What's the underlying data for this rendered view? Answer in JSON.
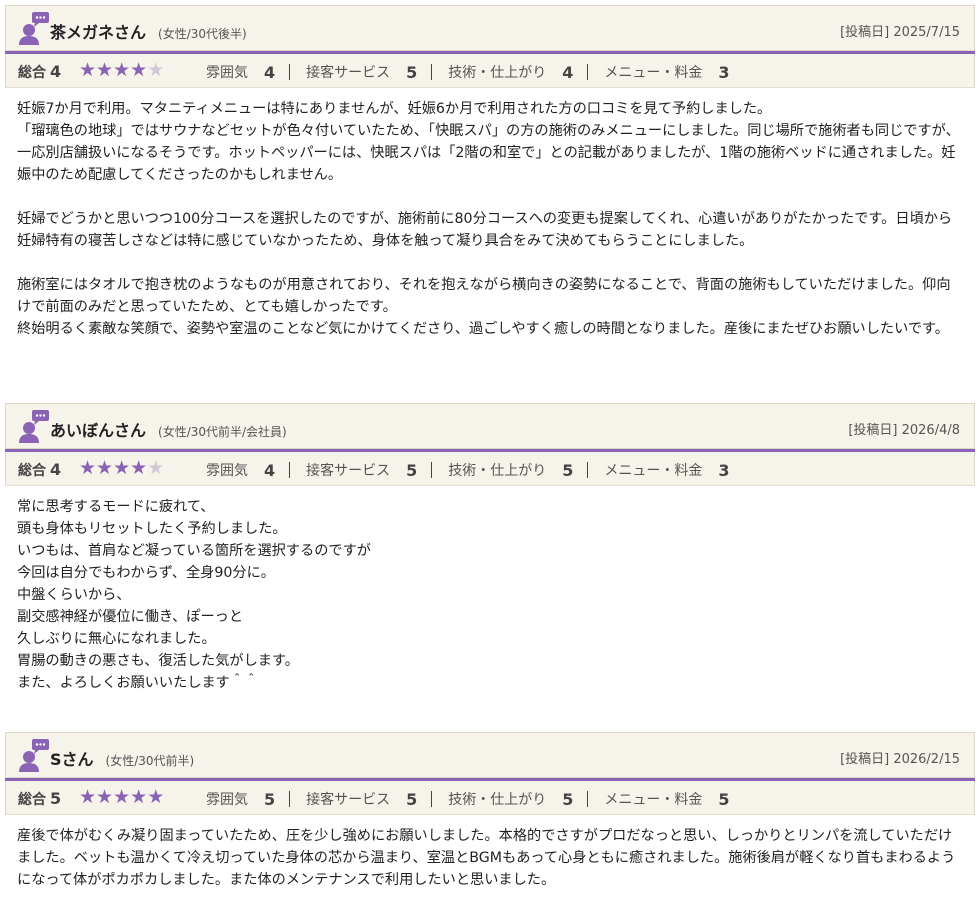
{
  "colors": {
    "accent": "#8a63b5",
    "header_bg": "#f6f3ea",
    "star_off": "#cfcbd6"
  },
  "reviews": [
    {
      "name": "茶メガネさん",
      "attr": "(女性/30代後半)",
      "date": "[投稿日] 2025/7/15",
      "total_label": "総合",
      "total": "4",
      "stars_filled": 4,
      "cats": [
        {
          "label": "雰囲気",
          "value": "4"
        },
        {
          "label": "接客サービス",
          "value": "5"
        },
        {
          "label": "技術・仕上がり",
          "value": "4"
        },
        {
          "label": "メニュー・料金",
          "value": "3"
        }
      ],
      "body": "妊娠7か月で利用。マタニティメニューは特にありませんが、妊娠6か月で利用された方の口コミを見て予約しました。\n「瑠璃色の地球」ではサウナなどセットが色々付いていたため、「快眠スパ」の方の施術のみメニューにしました。同じ場所で施術者も同じですが、一応別店舗扱いになるそうです。ホットペッパーには、快眠スパは「2階の和室で」との記載がありましたが、1階の施術ベッドに通されました。妊娠中のため配慮してくださったのかもしれません。\n\n妊婦でどうかと思いつつ100分コースを選択したのですが、施術前に80分コースへの変更も提案してくれ、心遣いがありがたかったです。日頃から妊婦特有の寝苦しさなどは特に感じていなかったため、身体を触って凝り具合をみて決めてもらうことにしました。\n\n施術室にはタオルで抱き枕のようなものが用意されており、それを抱えながら横向きの姿勢になることで、背面の施術もしていただけました。仰向けで前面のみだと思っていたため、とても嬉しかったです。\n終始明るく素敵な笑顔で、姿勢や室温のことなど気にかけてくださり、過ごしやすく癒しの時間となりました。産後にまたぜひお願いしたいです。"
    },
    {
      "name": "あいぼんさん",
      "attr": "(女性/30代前半/会社員)",
      "date": "[投稿日] 2026/4/8",
      "total_label": "総合",
      "total": "4",
      "stars_filled": 4,
      "cats": [
        {
          "label": "雰囲気",
          "value": "4"
        },
        {
          "label": "接客サービス",
          "value": "5"
        },
        {
          "label": "技術・仕上がり",
          "value": "5"
        },
        {
          "label": "メニュー・料金",
          "value": "3"
        }
      ],
      "body": "常に思考するモードに疲れて、\n頭も身体もリセットしたく予約しました。\nいつもは、首肩など凝っている箇所を選択するのですが\n今回は自分でもわからず、全身90分に。\n中盤くらいから、\n副交感神経が優位に働き、ぽーっと\n久しぶりに無心になれました。\n胃腸の動きの悪さも、復活した気がします。\nまた、よろしくお願いいたします＾＾"
    },
    {
      "name": "Sさん",
      "attr": "(女性/30代前半)",
      "date": "[投稿日] 2026/2/15",
      "total_label": "総合",
      "total": "5",
      "stars_filled": 5,
      "cats": [
        {
          "label": "雰囲気",
          "value": "5"
        },
        {
          "label": "接客サービス",
          "value": "5"
        },
        {
          "label": "技術・仕上がり",
          "value": "5"
        },
        {
          "label": "メニュー・料金",
          "value": "5"
        }
      ],
      "body": "産後で体がむくみ凝り固まっていたため、圧を少し強めにお願いしました。本格的でさすがプロだなっと思い、しっかりとリンパを流していただけました。ベットも温かくて冷え切っていた身体の芯から温まり、室温とBGMもあって心身ともに癒されました。施術後肩が軽くなり首もまわるようになって体がポカポカしました。また体のメンテナンスで利用したいと思いました。"
    }
  ]
}
